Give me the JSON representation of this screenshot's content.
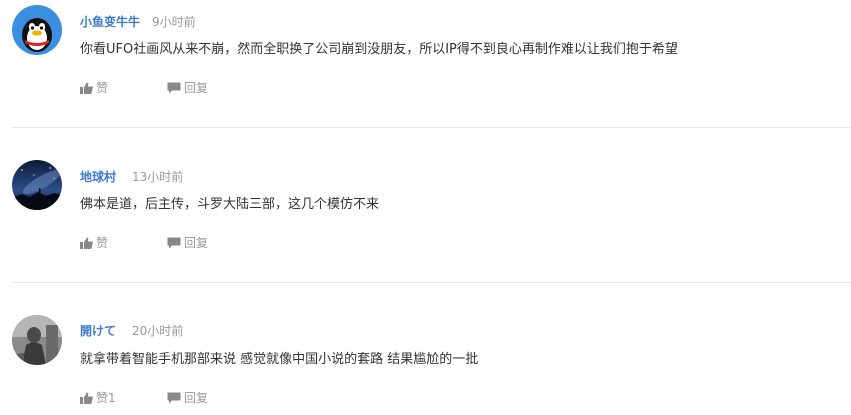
{
  "comments": [
    {
      "username": "小鱼变牛牛",
      "time": "9小时前",
      "content": "你看UFO社画风从来不崩，然而全职换了公司崩到没朋友，所以IP得不到良心再制作难以让我们抱于希望",
      "like_label": "赞",
      "reply_label": "回复",
      "avatar": "qq-penguin-avatar"
    },
    {
      "username": "地球村",
      "time": "13小时前",
      "content": "佛本是道，后主传，斗罗大陆三部，这几个模仿不来",
      "like_label": "赞",
      "reply_label": "回复",
      "avatar": "night-sky-avatar"
    },
    {
      "username": "開けて",
      "time": "20小时前",
      "content": "就拿带着智能手机那部来说 感觉就像中国小说的套路 结果尴尬的一批",
      "like_label": "赞1",
      "reply_label": "回复",
      "avatar": "grayscale-photo-avatar"
    }
  ],
  "colors": {
    "username": "#3e7bd0",
    "meta": "#999999",
    "text": "#333333",
    "divider": "#e8e8e8"
  },
  "icons": {
    "like": "thumbs-up-icon",
    "reply": "comment-bubble-icon"
  }
}
